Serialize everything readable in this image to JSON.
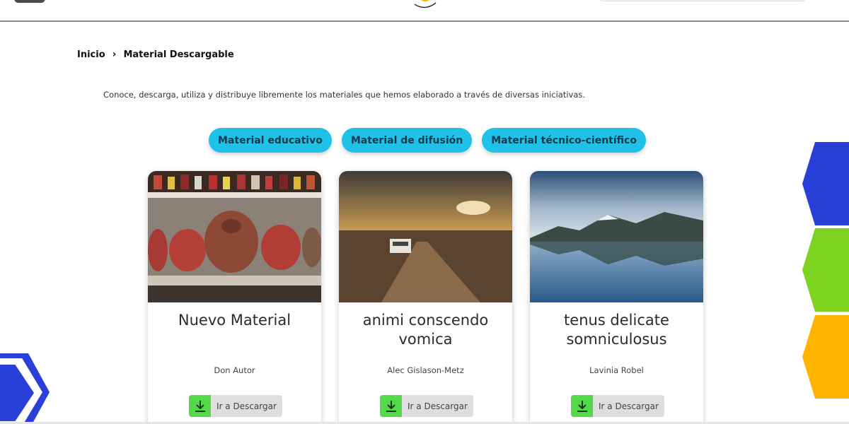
{
  "breadcrumb": {
    "home": "Inicio",
    "separator": "›",
    "current": "Material Descargable"
  },
  "intro": "Conoce, descarga, utiliza y distribuye libremente los materiales que hemos elaborado a través de diversas iniciativas.",
  "filters": [
    {
      "label": "Material educativo"
    },
    {
      "label": "Material de difusión"
    },
    {
      "label": "Material técnico-científico"
    }
  ],
  "cards": [
    {
      "title": "Nuevo Material",
      "author": "Don Autor",
      "button": "Ir a Descargar",
      "image": "clay-piggy-banks-photo"
    },
    {
      "title": "animi conscendo vomica",
      "author": "Alec Gislason-Metz",
      "button": "Ir a Descargar",
      "image": "desert-road-sunset-photo"
    },
    {
      "title": "tenus delicate somniculosus",
      "author": "Lavinia Robel",
      "button": "Ir a Descargar",
      "image": "mountain-lake-reflection-photo"
    }
  ],
  "colors": {
    "pill": "#1ec2e8",
    "download_icon_bg": "#53d94a",
    "hex_blue": "#2a3fd8",
    "hex_green": "#7ed321",
    "hex_orange": "#ffb400"
  }
}
